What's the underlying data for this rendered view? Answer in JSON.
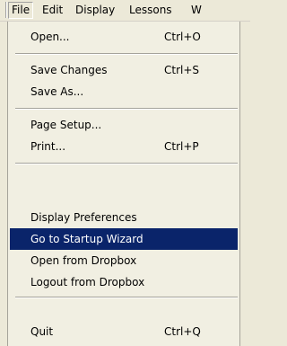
{
  "menubar": {
    "items": [
      "File",
      "Edit",
      "Display",
      "Lessons",
      "W"
    ]
  },
  "menu": {
    "items": [
      {
        "label": "Open...",
        "shortcut": "Ctrl+O"
      },
      {
        "label": "Save Changes",
        "shortcut": "Ctrl+S"
      },
      {
        "label": "Save As...",
        "shortcut": ""
      },
      {
        "label": "Page Setup...",
        "shortcut": ""
      },
      {
        "label": "Print...",
        "shortcut": "Ctrl+P"
      },
      {
        "label": "Display Preferences",
        "shortcut": ""
      },
      {
        "label": "Go to Startup Wizard",
        "shortcut": ""
      },
      {
        "label": "Open from Dropbox",
        "shortcut": ""
      },
      {
        "label": "Logout from Dropbox",
        "shortcut": ""
      },
      {
        "label": "Quit",
        "shortcut": "Ctrl+Q"
      }
    ],
    "highlighted": "Go to Startup Wizard"
  },
  "colors": {
    "highlight": "#0a246a",
    "background": "#ece9d8"
  }
}
